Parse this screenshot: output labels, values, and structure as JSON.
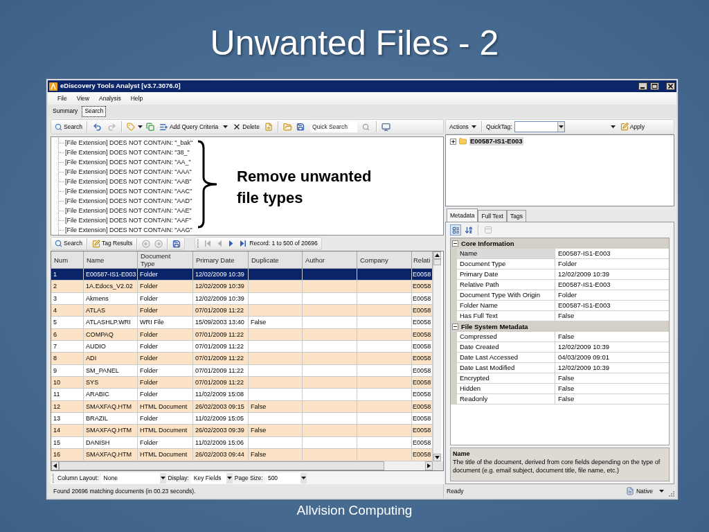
{
  "slide": {
    "title": "Unwanted Files - 2",
    "footer": "Allvision Computing"
  },
  "window": {
    "title": "eDiscovery Tools Analyst [v3.7.3076.0]"
  },
  "menu": [
    "File",
    "View",
    "Analysis",
    "Help"
  ],
  "view_tabs": [
    {
      "label": "Summary",
      "selected": false
    },
    {
      "label": "Search",
      "selected": true
    }
  ],
  "search_toolbar": {
    "search": "Search",
    "undo": {
      "disabled": false
    },
    "redo": {
      "disabled": true
    },
    "add_query_criteria": "Add Query Criteria",
    "delete": "Delete",
    "quick_search": {
      "placeholder": "Quick Search"
    }
  },
  "query_tree": {
    "items": [
      "[File Extension] DOES NOT CONTAIN: \"_bak\"",
      "[File Extension] DOES NOT CONTAIN: \"38_\"",
      "[File Extension] DOES NOT CONTAIN: \"AA_\"",
      "[File Extension] DOES NOT CONTAIN: \"AAA\"",
      "[File Extension] DOES NOT CONTAIN: \"AAB\"",
      "[File Extension] DOES NOT CONTAIN: \"AAC\"",
      "[File Extension] DOES NOT CONTAIN: \"AAD\"",
      "[File Extension] DOES NOT CONTAIN: \"AAE\"",
      "[File Extension] DOES NOT CONTAIN: \"AAF\"",
      "[File Extension] DOES NOT CONTAIN: \"AAG\""
    ]
  },
  "annotation": {
    "text": "Remove unwanted file types"
  },
  "results_toolbar": {
    "search": "Search",
    "tag_results": "Tag Results",
    "back": {
      "disabled": true
    },
    "forward": {
      "disabled": true
    },
    "first": {
      "disabled": true
    },
    "previous": {
      "disabled": true
    },
    "next": {
      "disabled": false
    },
    "last": {
      "disabled": false
    },
    "record": "Record: 1 to 500 of 20696"
  },
  "table": {
    "columns": [
      "Num",
      "Name",
      "Document Type",
      "Primary Date",
      "Duplicate",
      "Author",
      "Company",
      "Relati"
    ],
    "rows": [
      {
        "selected": true,
        "num": "1",
        "name": "E00587-IS1-E003",
        "document_type": "Folder",
        "primary_date": "12/02/2009 10:39",
        "column_8": "E0058"
      },
      {
        "selected": false,
        "num": "2",
        "name": "1A.Edocs_V2.02",
        "document_type": "Folder",
        "primary_date": "12/02/2009 10:39",
        "column_8": "E0058"
      },
      {
        "selected": false,
        "num": "3",
        "name": "Akmens",
        "document_type": "Folder",
        "primary_date": "12/02/2009 10:39",
        "column_8": "E0058"
      },
      {
        "selected": false,
        "num": "4",
        "name": "ATLAS",
        "document_type": "Folder",
        "primary_date": "07/01/2009 11:22",
        "column_8": "E0058"
      },
      {
        "selected": false,
        "num": "5",
        "name": "ATLASHLP.WRI",
        "document_type": "WRI File",
        "primary_date": "15/09/2003 13:40",
        "duplicate": "False",
        "column_8": "E0058"
      },
      {
        "selected": false,
        "num": "6",
        "name": "COMPAQ",
        "document_type": "Folder",
        "primary_date": "07/01/2009 11:22",
        "column_8": "E0058"
      },
      {
        "selected": false,
        "num": "7",
        "name": "AUDIO",
        "document_type": "Folder",
        "primary_date": "07/01/2009 11:22",
        "column_8": "E0058"
      },
      {
        "selected": false,
        "num": "8",
        "name": "ADI",
        "document_type": "Folder",
        "primary_date": "07/01/2009 11:22",
        "column_8": "E0058"
      },
      {
        "selected": false,
        "num": "9",
        "name": "SM_PANEL",
        "document_type": "Folder",
        "primary_date": "07/01/2009 11:22",
        "column_8": "E0058"
      },
      {
        "selected": false,
        "num": "10",
        "name": "SYS",
        "document_type": "Folder",
        "primary_date": "07/01/2009 11:22",
        "column_8": "E0058"
      },
      {
        "selected": false,
        "num": "11",
        "name": "ARABIC",
        "document_type": "Folder",
        "primary_date": "11/02/2009 15:08",
        "column_8": "E0058"
      },
      {
        "selected": false,
        "num": "12",
        "name": "SMAXFAQ.HTM",
        "document_type": "HTML Document",
        "primary_date": "26/02/2003 09:15",
        "duplicate": "False",
        "column_8": "E0058"
      },
      {
        "selected": false,
        "num": "13",
        "name": "BRAZIL",
        "document_type": "Folder",
        "primary_date": "11/02/2009 15:05",
        "column_8": "E0058"
      },
      {
        "selected": false,
        "num": "14",
        "name": "SMAXFAQ.HTM",
        "document_type": "HTML Document",
        "primary_date": "26/02/2003 09:39",
        "duplicate": "False",
        "column_8": "E0058"
      },
      {
        "selected": false,
        "num": "15",
        "name": "DANISH",
        "document_type": "Folder",
        "primary_date": "11/02/2009 15:06",
        "column_8": "E0058"
      },
      {
        "selected": false,
        "num": "16",
        "name": "SMAXFAQ.HTM",
        "document_type": "HTML Document",
        "primary_date": "26/02/2003 09:44",
        "duplicate": "False",
        "column_8": "E0058"
      }
    ]
  },
  "table_options": {
    "column_layout": {
      "label": "Column Layout:",
      "value": "None"
    },
    "display": {
      "label": "Display:",
      "value": "Key Fields"
    },
    "page_size": {
      "label": "Page Size:",
      "value": "500"
    }
  },
  "status_left": "Found 20696 matching documents (in 00.23 seconds).",
  "actions_toolbar": {
    "actions": "Actions",
    "quicktag_label": "QuickTag:",
    "apply": "Apply"
  },
  "document_tree": {
    "items": [
      {
        "label": "E00587-IS1-E003",
        "expanded": false,
        "selected": true
      }
    ]
  },
  "detail_tabs": [
    {
      "label": "Metadata",
      "selected": true
    },
    {
      "label": "Full Text",
      "selected": false
    },
    {
      "label": "Tags",
      "selected": false
    }
  ],
  "property_toolbar": {
    "categorized": {
      "selected": true
    },
    "alphabetical": {
      "selected": false
    },
    "property_pages": {
      "disabled": true
    }
  },
  "properties": {
    "categories": [
      {
        "name": "Core Information",
        "expanded": true,
        "rows": [
          {
            "name": "Name",
            "value": "E00587-IS1-E003",
            "selected": true
          },
          {
            "name": "Document Type",
            "value": "Folder",
            "selected": false
          },
          {
            "name": "Primary Date",
            "value": "12/02/2009 10:39",
            "selected": false
          },
          {
            "name": "Relative Path",
            "value": "E00587-IS1-E003",
            "selected": false
          },
          {
            "name": "Document Type With Origin",
            "value": "Folder",
            "selected": false
          },
          {
            "name": "Folder Name",
            "value": "E00587-IS1-E003",
            "selected": false
          },
          {
            "name": "Has Full Text",
            "value": "False",
            "selected": false
          }
        ]
      },
      {
        "name": "File System Metadata",
        "expanded": true,
        "rows": [
          {
            "name": "Compressed",
            "value": "False",
            "selected": false
          },
          {
            "name": "Date Created",
            "value": "12/02/2009 10:39",
            "selected": false
          },
          {
            "name": "Date Last Accessed",
            "value": "04/03/2009 09:01",
            "selected": false
          },
          {
            "name": "Date Last Modified",
            "value": "12/02/2009 10:39",
            "selected": false
          },
          {
            "name": "Encrypted",
            "value": "False",
            "selected": false
          },
          {
            "name": "Hidden",
            "value": "False",
            "selected": false
          },
          {
            "name": "Readonly",
            "value": "False",
            "selected": false
          }
        ]
      }
    ]
  },
  "description": {
    "title": "Name",
    "text": "The title of the document, derived from core fields depending on the type of document (e.g. email subject, document title, file name, etc.)"
  },
  "status_right": {
    "text": "Ready",
    "view_mode": "Native"
  }
}
